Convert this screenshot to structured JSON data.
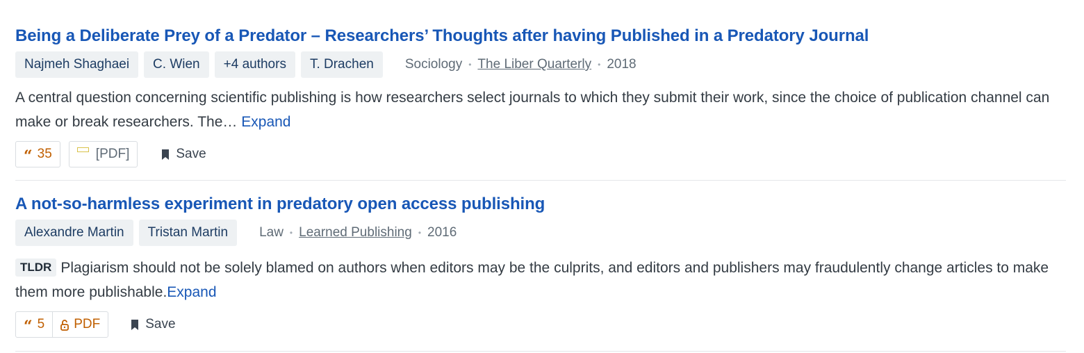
{
  "results": [
    {
      "title": "Being a Deliberate Prey of a Predator – Researchers’ Thoughts after having Published in a Predatory Journal",
      "authors": [
        "Najmeh Shaghaei",
        "C. Wien",
        "+4 authors",
        "T. Drachen"
      ],
      "field": "Sociology",
      "venue": "The Liber Quarterly",
      "year": "2018",
      "abstract": "A central question concerning scientific publishing is how researchers select journals to which they submit their work, since the choice of publication channel can make or break researchers. The…",
      "expand_label": "Expand",
      "citations": "35",
      "pdf_label": "[PDF]",
      "save_label": "Save"
    },
    {
      "title": "A not-so-harmless experiment in predatory open access publishing",
      "authors": [
        "Alexandre Martin",
        "Tristan Martin"
      ],
      "field": "Law",
      "venue": "Learned Publishing",
      "year": "2016",
      "tldr_label": "TLDR",
      "tldr": "Plagiarism should not be solely blamed on authors when editors may be the culprits, and editors and publishers may fraudulently change articles to make them more publishable.",
      "expand_label": "Expand",
      "citations": "5",
      "pdf_label": "PDF",
      "save_label": "Save"
    }
  ],
  "colors": {
    "title": "#1857b6",
    "chip_bg": "#eef1f3",
    "citation": "#c05f00",
    "meta": "#5f6b76"
  },
  "icons": {
    "citation": "quote-icon",
    "pdf": "pdf-icon",
    "open_access": "lock-icon",
    "save": "bookmark-icon"
  }
}
